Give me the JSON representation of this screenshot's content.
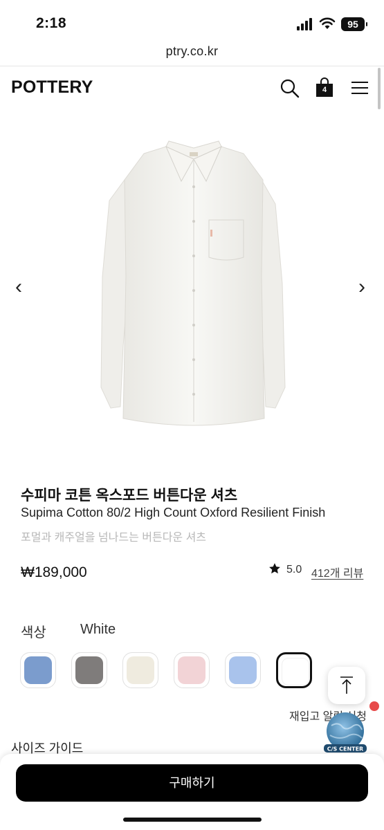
{
  "status_bar": {
    "time": "2:18",
    "battery": "95"
  },
  "browser": {
    "url": "ptry.co.kr"
  },
  "header": {
    "logo": "POTTERY",
    "cart_count": "4"
  },
  "gallery": {
    "prev": "‹",
    "next": "›"
  },
  "product": {
    "name_ko": "수피마 코튼 옥스포드 버튼다운 셔츠",
    "name_en": "Supima Cotton 80/2 High Count Oxford Resilient Finish",
    "subtitle": "포멀과 캐주얼을 넘나드는 버튼다운 셔츠",
    "price": "₩189,000",
    "rating": "5.0",
    "reviews": "412개 리뷰"
  },
  "color": {
    "label": "색상",
    "selected": "White",
    "swatches": [
      "#7b9ccd",
      "#7f7c7b",
      "#efebdf",
      "#f2d3d6",
      "#a9c3ec",
      "#ffffff"
    ]
  },
  "restock_notice": "재입고 알림 신청",
  "cs_badge": "C/S CENTER",
  "size_guide": "사이즈 가이드",
  "buy_button": "구매하기"
}
